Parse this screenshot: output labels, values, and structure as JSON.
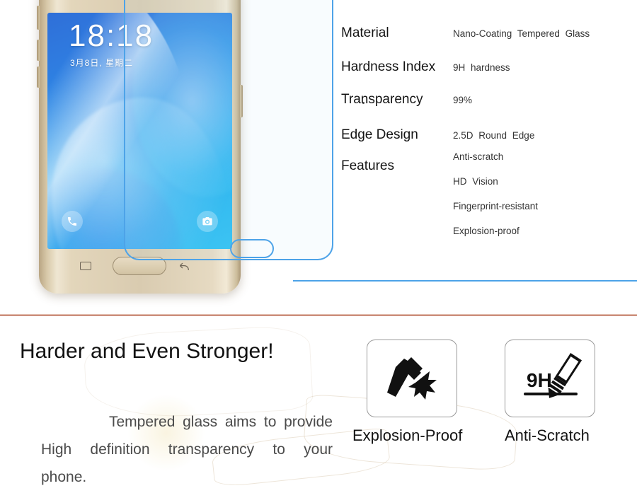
{
  "spec_table": {
    "rows": [
      {
        "label": "Material",
        "value": "Nano-Coating  Tempered  Glass"
      },
      {
        "label": "Hardness Index",
        "value": "9H  hardness"
      },
      {
        "label": "Transparency",
        "value": "99%"
      },
      {
        "label": "Edge Design",
        "value": "2.5D  Round  Edge"
      },
      {
        "label": "Features",
        "value": ""
      }
    ],
    "features": [
      "Anti-scratch",
      "HD  Vision",
      "Fingerprint-resistant",
      "Explosion-proof"
    ]
  },
  "phone": {
    "lock_time": "18:18",
    "lock_date": "3月8日, 星期二",
    "shortcut_left": "phone-icon",
    "shortcut_right": "camera-icon"
  },
  "promo": {
    "headline": "Harder and Even Stronger!",
    "body": "Tempered glass aims to provide High definition transparency to your phone."
  },
  "badges": [
    {
      "label": "Explosion-Proof",
      "icon": "hammer-impact-icon"
    },
    {
      "label": "Anti-Scratch",
      "icon": "pencil-9h-hardness-icon",
      "text": "9H"
    }
  ],
  "colors": {
    "divider": "#a8442a",
    "glass_outline": "#4da3e8",
    "screen_blue": "#2f6fd8",
    "screen_cyan": "#2ec1f2"
  }
}
